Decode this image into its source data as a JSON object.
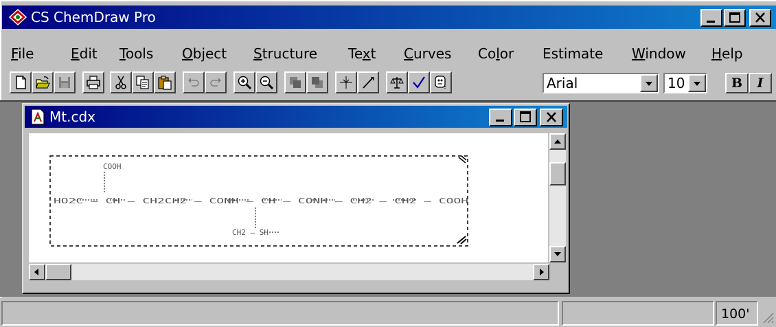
{
  "app": {
    "title": "CS ChemDraw Pro"
  },
  "menu": {
    "items": [
      {
        "pre": "",
        "key": "F",
        "post": "ile"
      },
      {
        "pre": "",
        "key": "E",
        "post": "dit"
      },
      {
        "pre": "",
        "key": "T",
        "post": "ools"
      },
      {
        "pre": "",
        "key": "O",
        "post": "bject"
      },
      {
        "pre": "",
        "key": "S",
        "post": "tructure"
      },
      {
        "pre": "Te",
        "key": "x",
        "post": "t"
      },
      {
        "pre": "",
        "key": "C",
        "post": "urves"
      },
      {
        "pre": "Co",
        "key": "l",
        "post": "or"
      },
      {
        "pre": "Estimate",
        "key": "",
        "post": ""
      },
      {
        "pre": "",
        "key": "W",
        "post": "indow"
      },
      {
        "pre": "",
        "key": "H",
        "post": "elp"
      }
    ]
  },
  "toolbar": {
    "font_name": "Arial",
    "font_size": "10",
    "bold_label": "B",
    "italic_label": "I"
  },
  "document": {
    "title": "Mt.cdx",
    "structure": {
      "main_chain": "HO2C — CH — CH2CH2 — CONH — CH — CONH — CH2 — CH2 — COOH",
      "branch_top": "COOH",
      "branch_bottom": "CH2 — SH"
    }
  },
  "status": {
    "zoom": "100'"
  },
  "colors": {
    "titlebar_start": "#000080",
    "titlebar_end": "#1084d0",
    "face": "#c0c0c0",
    "workspace": "#808080"
  }
}
